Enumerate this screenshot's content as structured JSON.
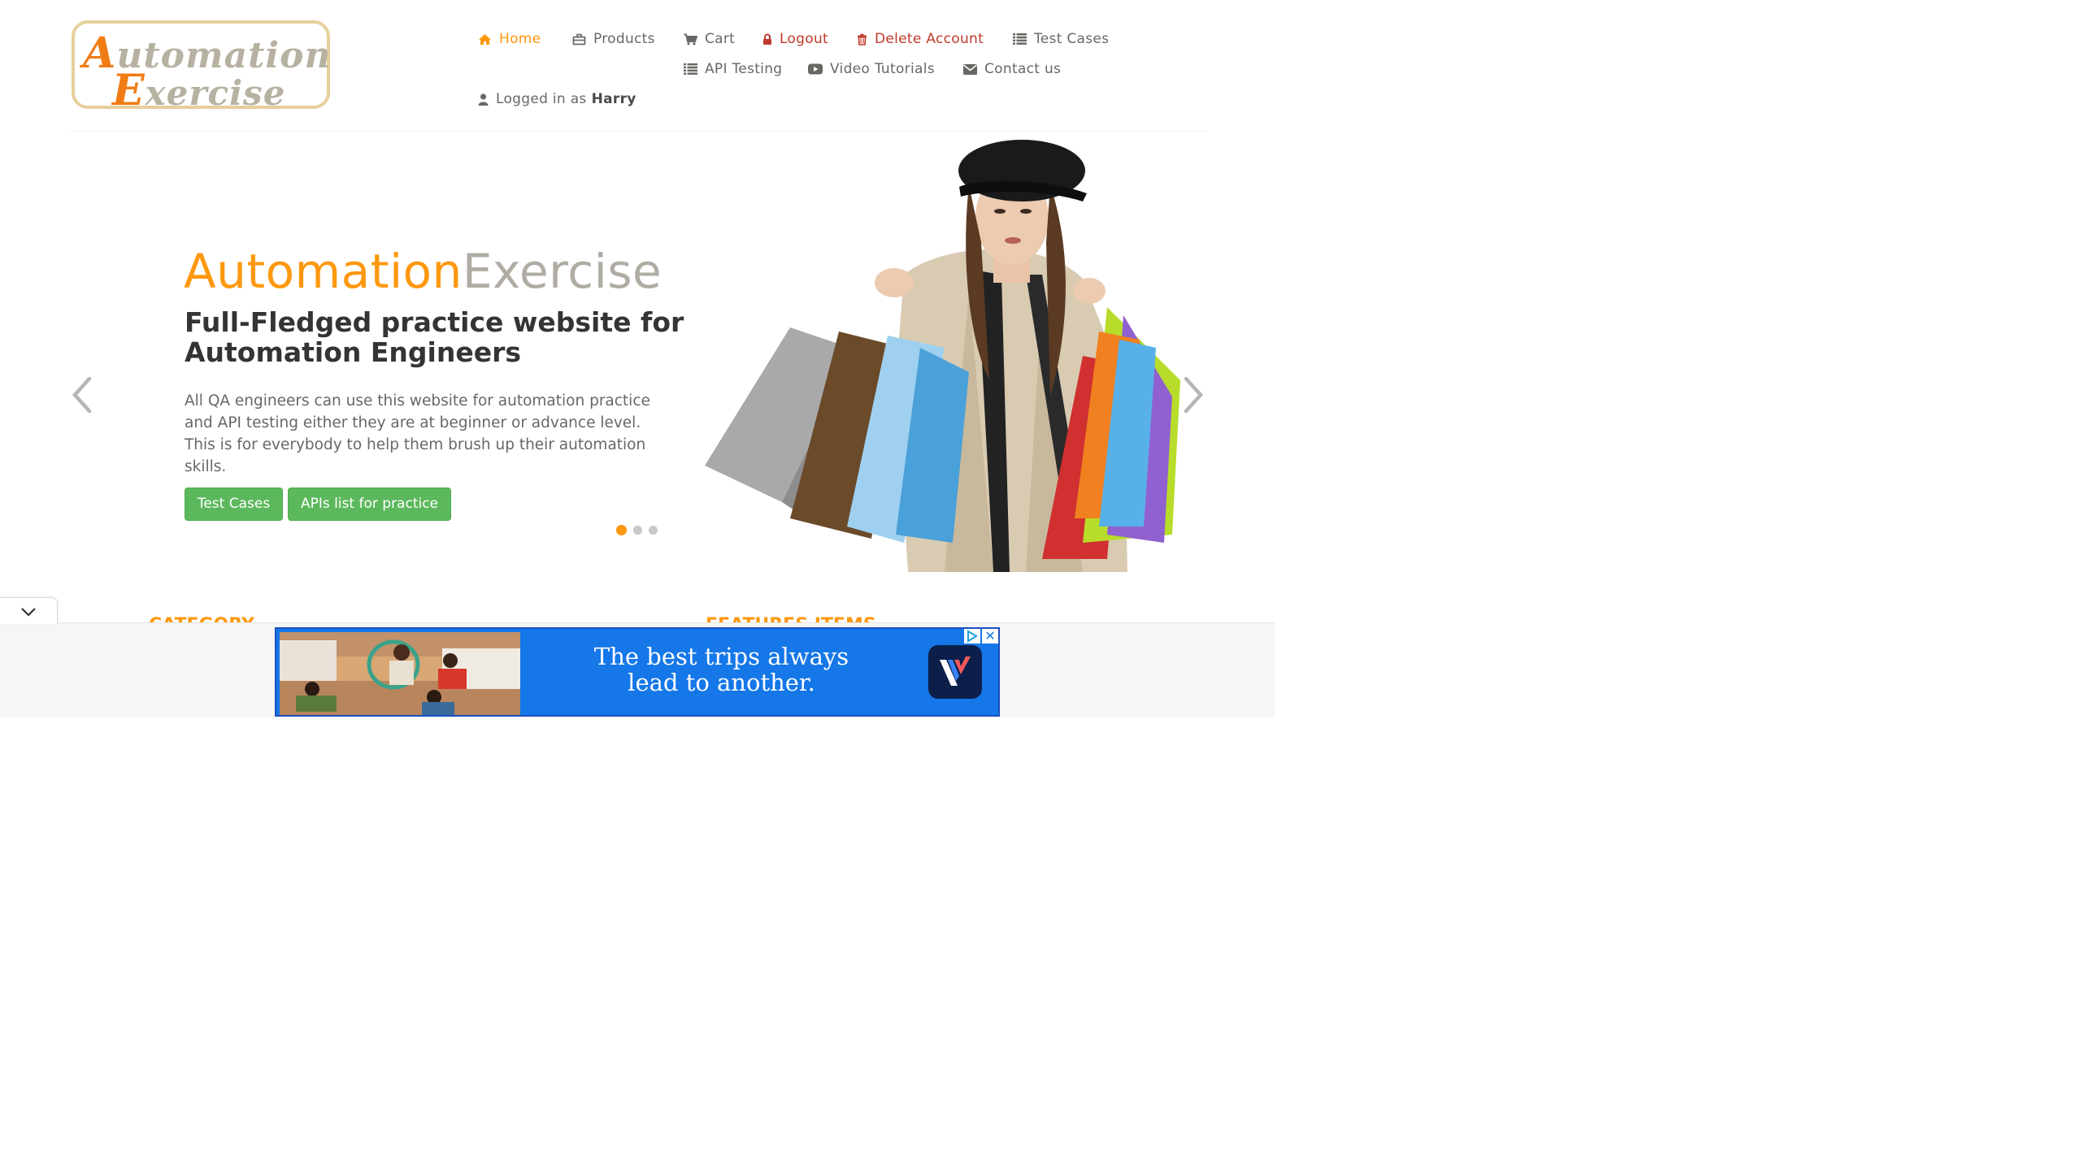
{
  "logo": {
    "line1_cap": "A",
    "line1_rest": "utomation",
    "line2_cap": "E",
    "line2_rest": "xercise"
  },
  "nav": {
    "home": "Home",
    "products": "Products",
    "cart": "Cart",
    "logout": "Logout",
    "delete_account": "Delete Account",
    "test_cases": "Test Cases",
    "api_testing": "API Testing",
    "video_tutorials": "Video Tutorials",
    "contact_us": "Contact us",
    "logged_in_prefix": "Logged in as",
    "username": "Harry"
  },
  "slider": {
    "brand_part1": "Automation",
    "brand_part2": "Exercise",
    "headline": "Full-Fledged practice website for Automation Engineers",
    "description": "All QA engineers can use this website for automation practice and API testing either they are at beginner or advance level. This is for everybody to help them brush up their automation skills.",
    "button_test_cases": "Test Cases",
    "button_apis": "APIs list for practice",
    "active_slide": 1,
    "slide_count": 3
  },
  "sections": {
    "category": "CATEGORY",
    "features": "FEATURES ITEMS"
  },
  "ad": {
    "tagline": "The best trips always lead to another.",
    "close": "✕"
  },
  "colors": {
    "accent": "#fe980f",
    "button": "#5cb85c",
    "danger": "#c0392b",
    "text": "#696763",
    "ad_blue": "#1577e8"
  },
  "icons": {
    "home": "home-icon",
    "products": "briefcase-icon",
    "cart": "shopping-cart-icon",
    "logout": "lock-icon",
    "delete": "trash-icon",
    "test_cases": "list-icon",
    "api_testing": "list-icon",
    "video": "youtube-play-icon",
    "contact": "envelope-icon",
    "user": "user-icon"
  }
}
